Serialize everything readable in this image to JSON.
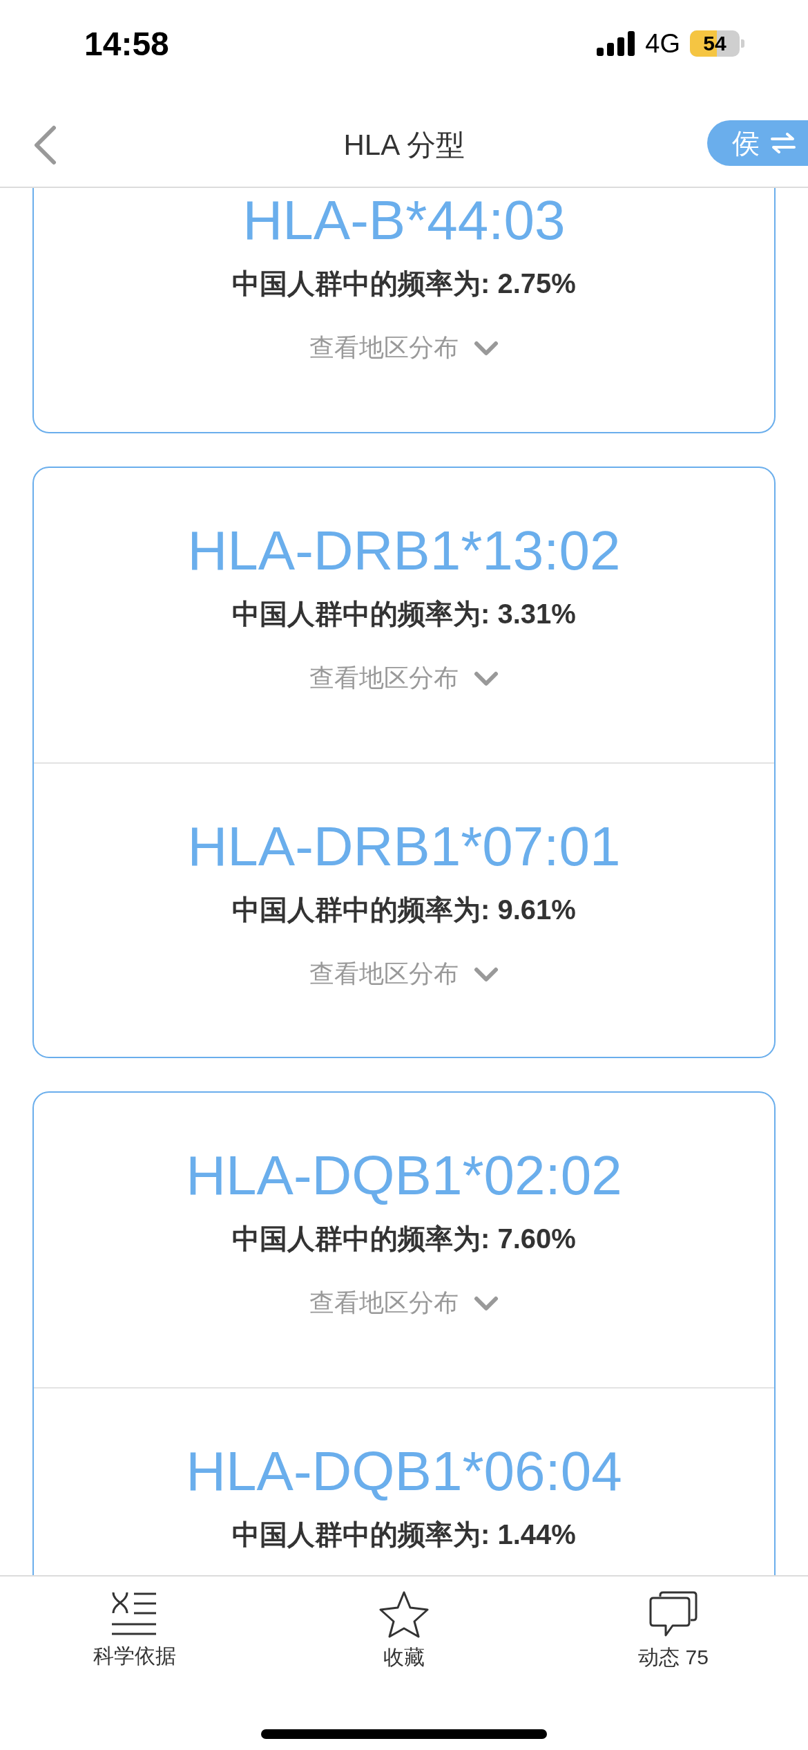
{
  "status_bar": {
    "time": "14:58",
    "network": "4G",
    "battery": "54"
  },
  "header": {
    "title": "HLA 分型",
    "switch_button": "侯"
  },
  "cards": [
    {
      "alleles": [
        {
          "name": "HLA-B*44:03",
          "frequency": "中国人群中的频率为: 2.75%",
          "region_link": "查看地区分布"
        }
      ]
    },
    {
      "alleles": [
        {
          "name": "HLA-DRB1*13:02",
          "frequency": "中国人群中的频率为: 3.31%",
          "region_link": "查看地区分布"
        },
        {
          "name": "HLA-DRB1*07:01",
          "frequency": "中国人群中的频率为: 9.61%",
          "region_link": "查看地区分布"
        }
      ]
    },
    {
      "alleles": [
        {
          "name": "HLA-DQB1*02:02",
          "frequency": "中国人群中的频率为: 7.60%",
          "region_link": "查看地区分布"
        },
        {
          "name": "HLA-DQB1*06:04",
          "frequency": "中国人群中的频率为: 1.44%"
        }
      ]
    }
  ],
  "tab_bar": [
    {
      "kind": "basis",
      "label": "科学依据"
    },
    {
      "kind": "favorite",
      "label": "收藏"
    },
    {
      "kind": "feed",
      "label": "动态 75"
    }
  ]
}
